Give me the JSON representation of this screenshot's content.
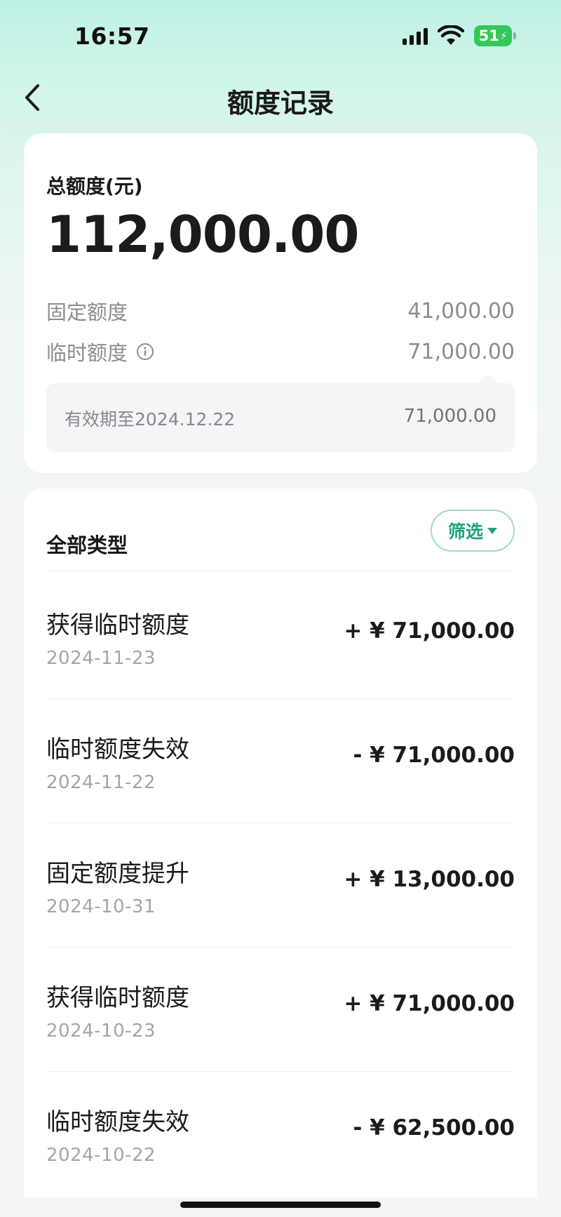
{
  "status_bar": {
    "time": "16:57",
    "battery": "51",
    "icons": [
      "signal-icon",
      "wifi-icon",
      "battery-charging-icon"
    ]
  },
  "nav": {
    "title": "额度记录",
    "back_icon": "chevron-left-icon"
  },
  "summary": {
    "total_label": "总额度(元)",
    "total_value": "112,000.00",
    "fixed_label": "固定额度",
    "fixed_value": "41,000.00",
    "temp_label": "临时额度",
    "temp_value": "71,000.00",
    "expiry_label": "有效期至2024.12.22",
    "expiry_value": "71,000.00"
  },
  "records": {
    "type_label": "全部类型",
    "filter_label": "筛选",
    "items": [
      {
        "title": "获得临时额度",
        "date": "2024-11-23",
        "amount": "+ ¥ 71,000.00"
      },
      {
        "title": "临时额度失效",
        "date": "2024-11-22",
        "amount": "- ¥ 71,000.00"
      },
      {
        "title": "固定额度提升",
        "date": "2024-10-31",
        "amount": "+ ¥ 13,000.00"
      },
      {
        "title": "获得临时额度",
        "date": "2024-10-23",
        "amount": "+ ¥ 71,000.00"
      },
      {
        "title": "临时额度失效",
        "date": "2024-10-22",
        "amount": "- ¥ 62,500.00"
      }
    ]
  },
  "colors": {
    "accent": "#1ca37e",
    "battery": "#35c759",
    "header_mint": "#bdf1e4"
  }
}
